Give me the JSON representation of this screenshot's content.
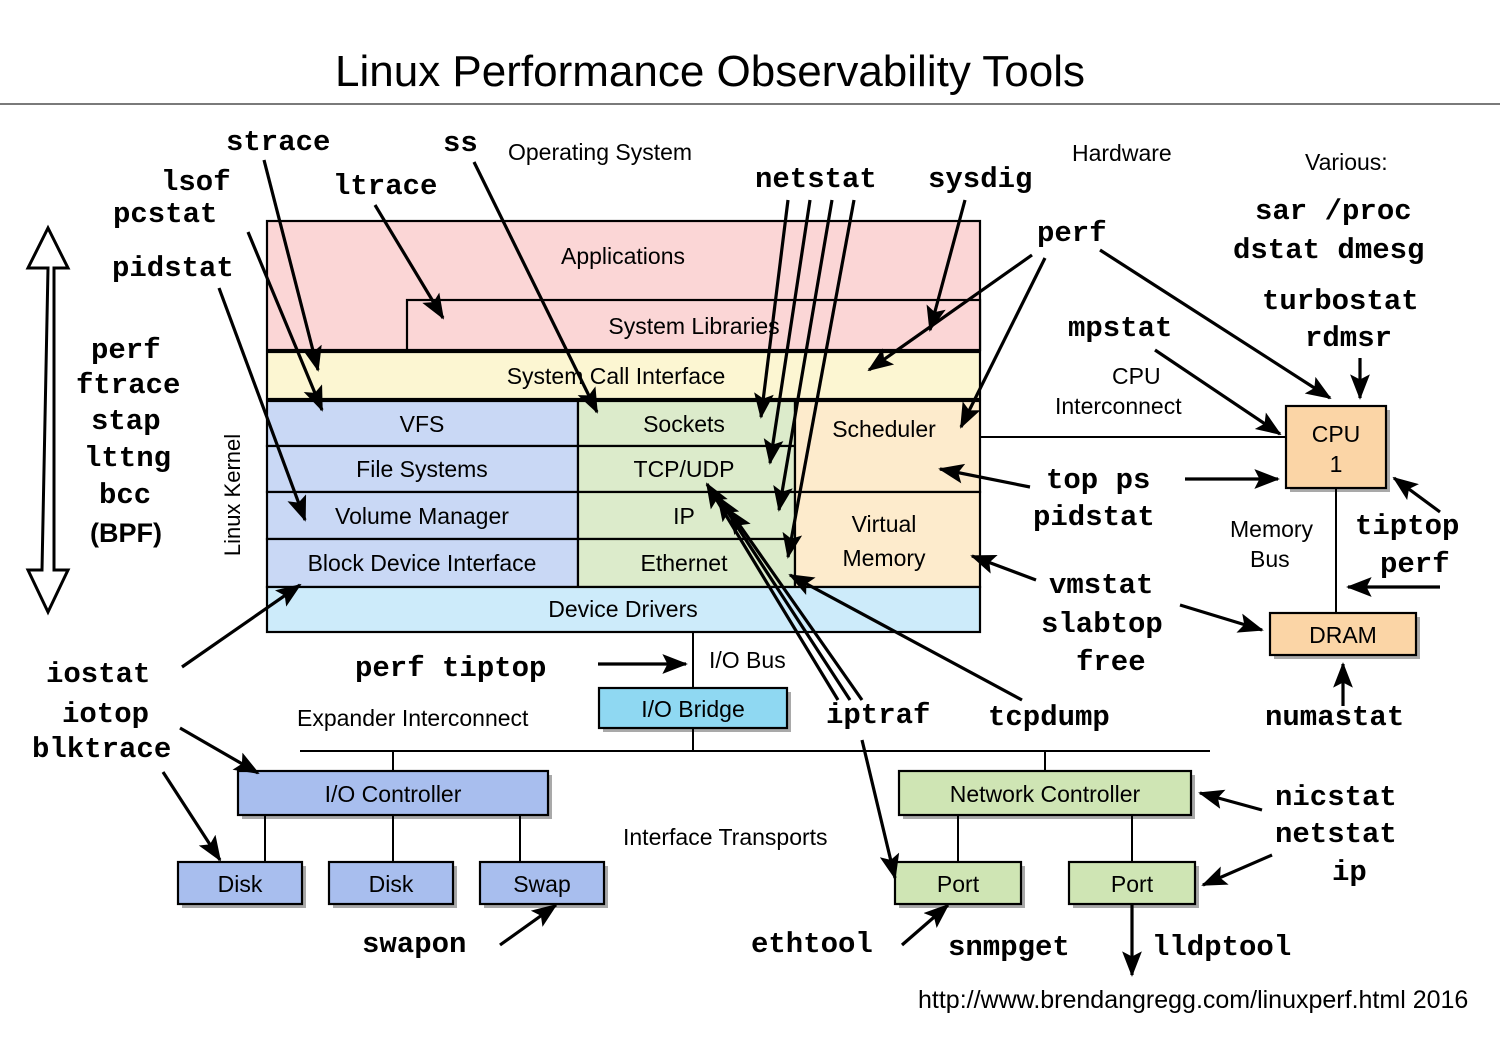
{
  "page": {
    "title": "Linux Performance Observability Tools",
    "footer": "http://www.brendangregg.com/linuxperf.html 2016"
  },
  "section_labels": {
    "operating_system": "Operating System",
    "hardware": "Hardware",
    "various": "Various:",
    "linux_kernel": "Linux Kernel",
    "cpu_interconnect_1": "CPU",
    "cpu_interconnect_2": "Interconnect",
    "memory_bus_1": "Memory",
    "memory_bus_2": "Bus",
    "io_bus": "I/O Bus",
    "expander_interconnect": "Expander Interconnect",
    "interface_transports": "Interface Transports"
  },
  "os_stack": {
    "applications": "Applications",
    "system_libraries": "System Libraries",
    "system_call_interface": "System Call Interface",
    "vfs": "VFS",
    "file_systems": "File Systems",
    "volume_manager": "Volume Manager",
    "block_device_interface": "Block Device Interface",
    "sockets": "Sockets",
    "tcp_udp": "TCP/UDP",
    "ip": "IP",
    "ethernet": "Ethernet",
    "scheduler": "Scheduler",
    "virtual_memory_1": "Virtual",
    "virtual_memory_2": "Memory",
    "device_drivers": "Device Drivers"
  },
  "hardware_boxes": {
    "cpu_1": "CPU",
    "cpu_2": "1",
    "dram": "DRAM",
    "io_bridge": "I/O Bridge",
    "io_controller": "I/O Controller",
    "disk_1": "Disk",
    "disk_2": "Disk",
    "swap": "Swap",
    "network_controller": "Network Controller",
    "port_1": "Port",
    "port_2": "Port"
  },
  "tools": {
    "strace": "strace",
    "lsof": "lsof",
    "pcstat": "pcstat",
    "ltrace": "ltrace",
    "ss": "ss",
    "pidstat": "pidstat",
    "netstat_top": "netstat",
    "sysdig": "sysdig",
    "perf_hw": "perf",
    "sar_proc": "sar /proc",
    "dstat_dmesg": "dstat dmesg",
    "turbostat": "turbostat",
    "rdmsr": "rdmsr",
    "mpstat": "mpstat",
    "tracing_perf": "perf",
    "tracing_ftrace": "ftrace",
    "tracing_stap": "stap",
    "tracing_lttng": "lttng",
    "tracing_bcc": "bcc",
    "tracing_bpf": "(BPF)",
    "top_ps": "top ps",
    "pidstat_cpu": "pidstat",
    "tiptop": "tiptop",
    "perf_mem": "perf",
    "vmstat": "vmstat",
    "slabtop": "slabtop",
    "free": "free",
    "numastat": "numastat",
    "iostat": "iostat",
    "iotop": "iotop",
    "blktrace": "blktrace",
    "perf_tiptop": "perf tiptop",
    "iptraf": "iptraf",
    "tcpdump": "tcpdump",
    "swapon": "swapon",
    "nicstat": "nicstat",
    "netstat_nic": "netstat",
    "ip": "ip",
    "ethtool": "ethtool",
    "snmpget": "snmpget",
    "lldptool": "lldptool"
  },
  "colors": {
    "applications_pink": "#FBD6D6",
    "syscall_yellow": "#FCF6D2",
    "kernel_blue": "#C9D8F5",
    "net_green": "#DCEBCB",
    "cpu_orange": "#FDEBCC",
    "device_drivers_blue": "#CDEBFA",
    "io_bridge_cyan": "#8FD8F2",
    "io_blue": "#A8BEEE",
    "net_box_green": "#CFE5B4",
    "hw_orange": "#FBD5A6",
    "footer_gray": "#D8D8D8",
    "rule_gray": "#7A7A7A"
  }
}
